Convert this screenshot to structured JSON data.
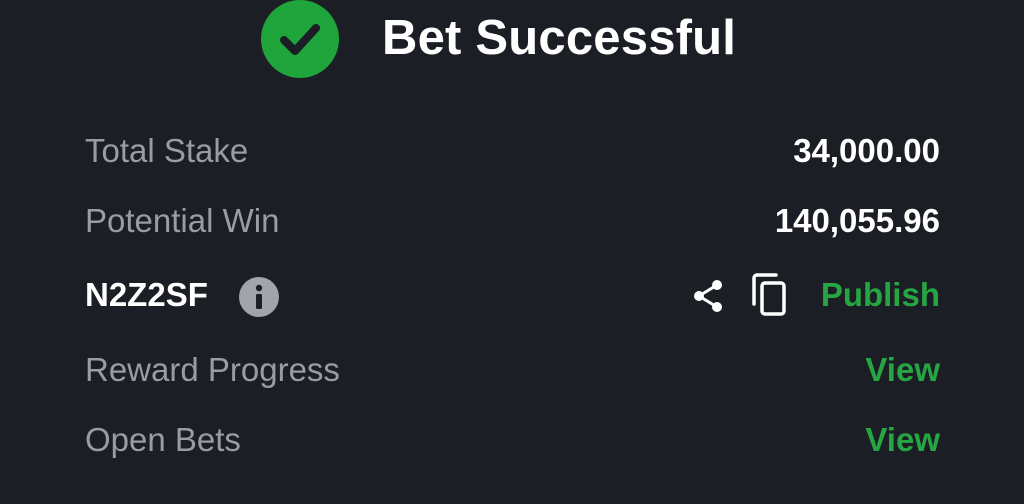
{
  "header": {
    "title": "Bet Successful",
    "status_color": "#1fa53b",
    "icon": "check-circle-icon"
  },
  "summary": {
    "total_stake": {
      "label": "Total Stake",
      "value": "34,000.00"
    },
    "potential_win": {
      "label": "Potential Win",
      "value": "140,055.96"
    }
  },
  "booking": {
    "code": "N2Z2SF",
    "info_icon": "info-icon",
    "share_icon": "share-icon",
    "copy_icon": "copy-icon",
    "publish_label": "Publish"
  },
  "links": {
    "reward_progress": {
      "label": "Reward Progress",
      "action": "View"
    },
    "open_bets": {
      "label": "Open Bets",
      "action": "View"
    }
  },
  "colors": {
    "background": "#1c1e25",
    "accent": "#26a643",
    "muted_text": "#9a9ba3",
    "primary_text": "#ffffff"
  }
}
